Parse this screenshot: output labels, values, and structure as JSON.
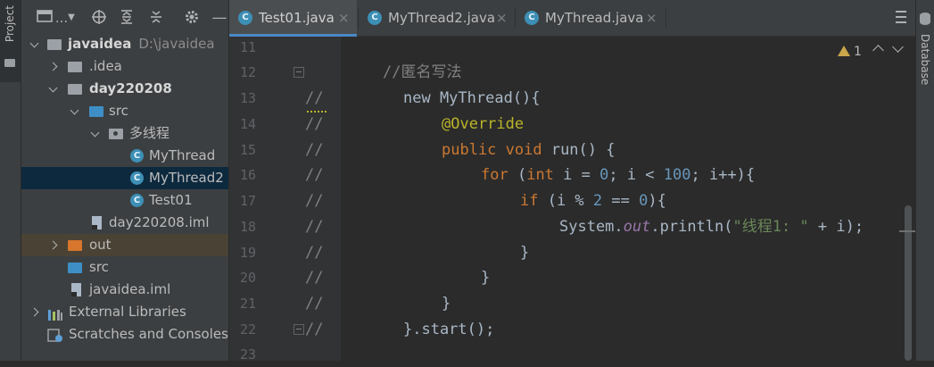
{
  "left_strip": {
    "project_label": "Project"
  },
  "project": {
    "toolbar": {
      "view_mode": "...",
      "collapse_hint": "—"
    },
    "tree": [
      {
        "label": "javaidea",
        "path": "D:\\javaidea",
        "bold": true
      },
      {
        "label": ".idea"
      },
      {
        "label": "day220208",
        "bold": true
      },
      {
        "label": "src"
      },
      {
        "label": "多线程"
      },
      {
        "label": "MyThread"
      },
      {
        "label": "MyThread2"
      },
      {
        "label": "Test01"
      },
      {
        "label": "day220208.iml"
      },
      {
        "label": "out"
      },
      {
        "label": "src"
      },
      {
        "label": "javaidea.iml"
      },
      {
        "label": "External Libraries"
      },
      {
        "label": "Scratches and Consoles"
      }
    ]
  },
  "tabs": [
    {
      "name": "Test01.java",
      "close": "×",
      "active": true
    },
    {
      "name": "MyThread2.java",
      "close": "×",
      "active": false
    },
    {
      "name": "MyThread.java",
      "close": "×",
      "active": false
    }
  ],
  "editor": {
    "line_numbers": [
      "11",
      "12",
      "13",
      "14",
      "15",
      "16",
      "17",
      "18",
      "19",
      "20",
      "21",
      "22",
      "23"
    ],
    "warnings_count": "1",
    "code": {
      "l12": "//匿名写法",
      "comment_marker": "//",
      "l13": "new MyThread(){",
      "l14": "@Override",
      "l15_kw": "public void",
      "l15_rest": " run() {",
      "l16_kw": "for",
      "l16_a": " (",
      "l16_int": "int",
      "l16_b": " i = ",
      "l16_n0": "0",
      "l16_c": "; i < ",
      "l16_n100": "100",
      "l16_d": "; i++){",
      "l17_kw": "if",
      "l17_a": " (i % ",
      "l17_n2": "2",
      "l17_b": " == ",
      "l17_n0": "0",
      "l17_c": "){",
      "l18_a": "System.",
      "l18_out": "out",
      "l18_b": ".println(",
      "l18_str": "\"线程1: \"",
      "l18_c": " + i);",
      "brace": "}",
      "l22": "}.start();"
    }
  },
  "right_strip": {
    "database_label": "Database"
  }
}
